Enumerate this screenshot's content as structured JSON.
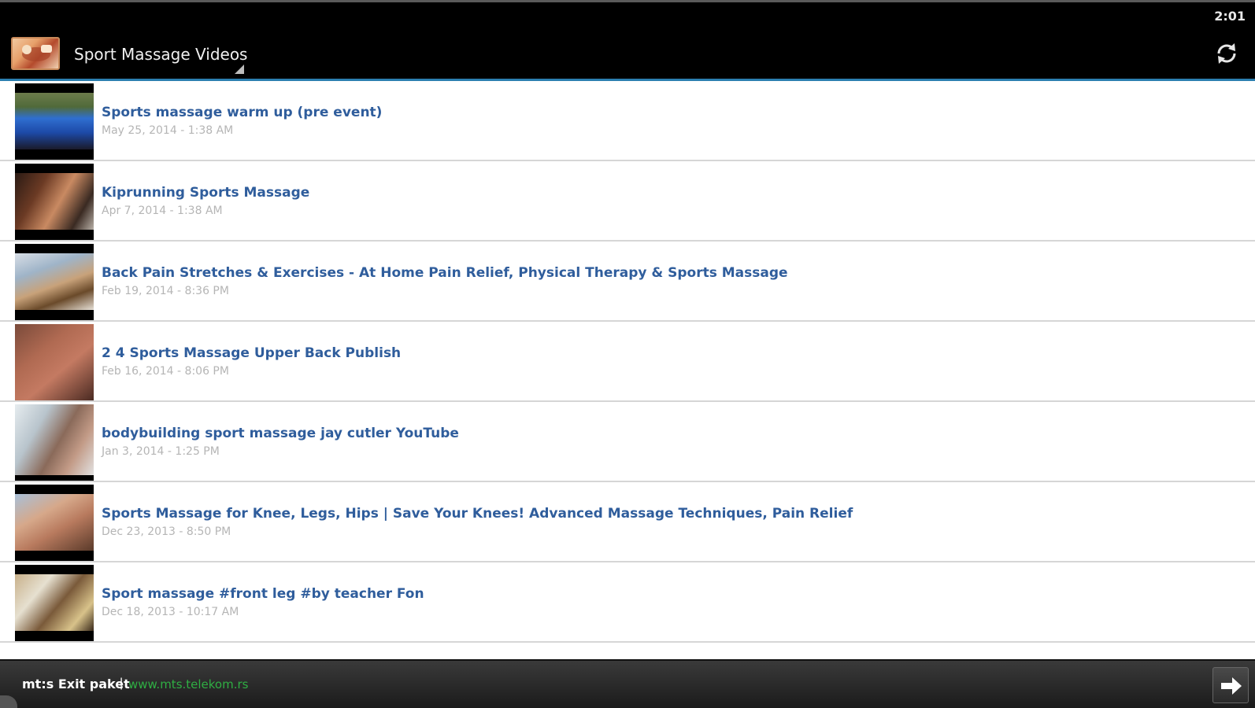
{
  "status_bar": {
    "time": "2:01"
  },
  "action_bar": {
    "title": "Sport Massage Videos",
    "icons": {
      "app": "app-logo-icon",
      "refresh": "refresh-icon"
    }
  },
  "videos": [
    {
      "title": "Sports massage warm up (pre event)",
      "date": "May 25, 2014 - 1:38 AM"
    },
    {
      "title": "Kiprunning Sports Massage",
      "date": "Apr 7, 2014 - 1:38 AM"
    },
    {
      "title": "Back Pain Stretches & Exercises - At Home Pain Relief, Physical Therapy & Sports Massage",
      "date": "Feb 19, 2014 - 8:36 PM"
    },
    {
      "title": "2 4 Sports Massage Upper Back Publish",
      "date": "Feb 16, 2014 - 8:06 PM"
    },
    {
      "title": "bodybuilding sport massage jay cutler YouTube",
      "date": "Jan 3, 2014 - 1:25 PM"
    },
    {
      "title": "Sports Massage for Knee, Legs, Hips | Save Your Knees! Advanced Massage Techniques, Pain Relief",
      "date": "Dec 23, 2013 - 8:50 PM"
    },
    {
      "title": "Sport massage #front leg #by teacher Fon",
      "date": "Dec 18, 2013 - 10:17 AM"
    }
  ],
  "ad": {
    "brand": "mt:s Exit paket",
    "separator": "|",
    "link": "www.mts.telekom.rs"
  },
  "colors": {
    "accent_line": "#2b7fb0",
    "title_link": "#2f5d9c",
    "date_text": "#b5b5b5",
    "ad_link": "#2fae43"
  }
}
